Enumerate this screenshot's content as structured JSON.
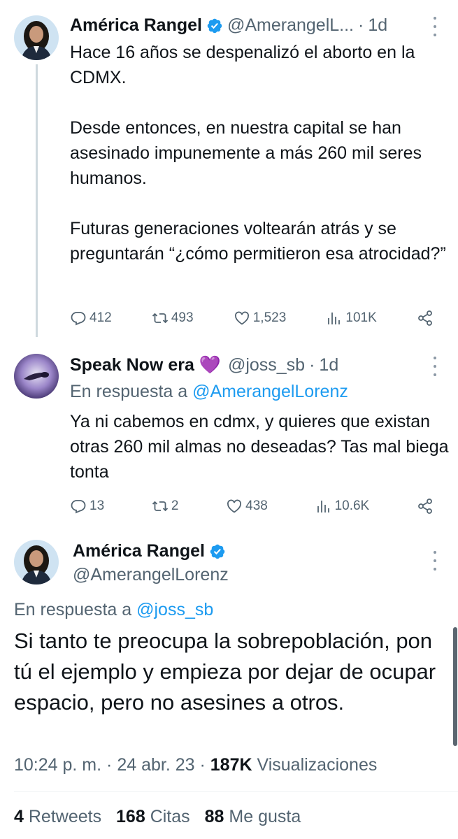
{
  "tweet1": {
    "author_name": "América Rangel",
    "author_handle": "@AmerangelL...",
    "separator": "·",
    "time": "1d",
    "text": "Hace 16 años se despenalizó el aborto en la CDMX.\n\nDesde entonces, en nuestra capital se han asesinado impunemente a más 260 mil seres humanos.\n\nFuturas generaciones voltearán atrás y se preguntarán “¿cómo permitieron esa atrocidad?”",
    "replies": "412",
    "retweets": "493",
    "likes": "1,523",
    "views": "101K",
    "icons": {
      "reply": "reply-icon",
      "retweet": "retweet-icon",
      "like": "heart-icon",
      "views": "views-icon",
      "share": "share-icon",
      "verified": "verified-badge-icon"
    }
  },
  "tweet2": {
    "author_name": "Speak Now era 💜",
    "author_handle": "@joss_sb",
    "separator": "·",
    "time": "1d",
    "reply_prefix": "En respuesta a ",
    "reply_handle": "@AmerangelLorenz",
    "text": "Ya ni cabemos en cdmx, y quieres que existan otras 260 mil almas no deseadas? Tas mal biega tonta",
    "replies": "13",
    "retweets": "2",
    "likes": "438",
    "views": "10.6K"
  },
  "main": {
    "author_name": "América Rangel",
    "author_handle": "@AmerangelLorenz",
    "reply_prefix": "En respuesta a ",
    "reply_handle": "@joss_sb",
    "text": "Si tanto te preocupa la sobrepoblación, pon tú el ejemplo y empieza por dejar de ocupar espacio, pero no asesines a otros.",
    "time": "10:24 p. m.",
    "date": "24 abr. 23",
    "views_count": "187K",
    "views_label": "Visualizaciones",
    "retweets_count": "4",
    "retweets_label": "Retweets",
    "quotes_count": "168",
    "quotes_label": "Citas",
    "likes_count": "88",
    "likes_label": "Me gusta"
  },
  "colors": {
    "link": "#1d9bf0",
    "verified": "#1d9bf0",
    "secondary": "#536471",
    "primary": "#0f1419",
    "heart": "#f91880"
  }
}
